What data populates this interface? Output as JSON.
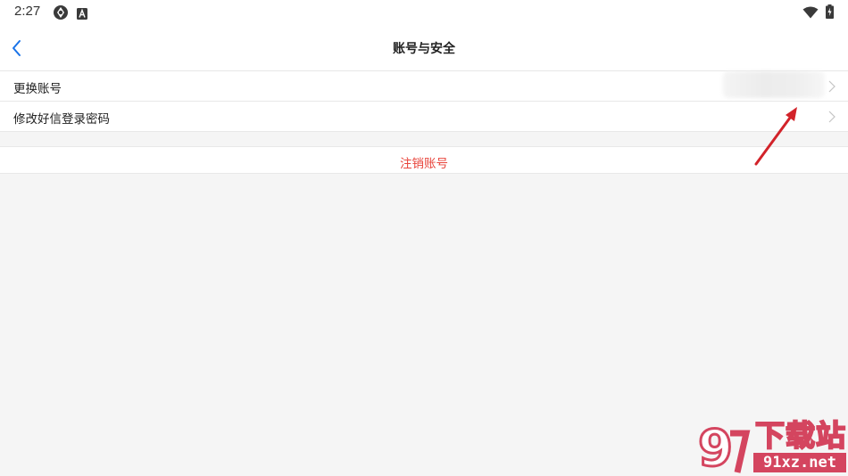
{
  "status_bar": {
    "time": "2:27",
    "icons": [
      "sync-icon",
      "app-a-icon",
      "wifi-icon",
      "battery-charging-icon"
    ]
  },
  "nav": {
    "back_icon": "chevron-left-icon",
    "title": "账号与安全"
  },
  "list": {
    "items": [
      {
        "label": "更换账号",
        "value_obscured": true
      },
      {
        "label": "修改好信登录密码"
      }
    ]
  },
  "danger": {
    "label": "注销账号"
  },
  "watermark": {
    "brand": "下载站",
    "url": "91xz.net",
    "logo_text": "9"
  },
  "colors": {
    "accent_blue": "#1a73e8",
    "danger_red": "#e8453c",
    "annotation_arrow": "#d2232a",
    "watermark": "#d4455f",
    "page_bg": "#f5f5f5"
  }
}
